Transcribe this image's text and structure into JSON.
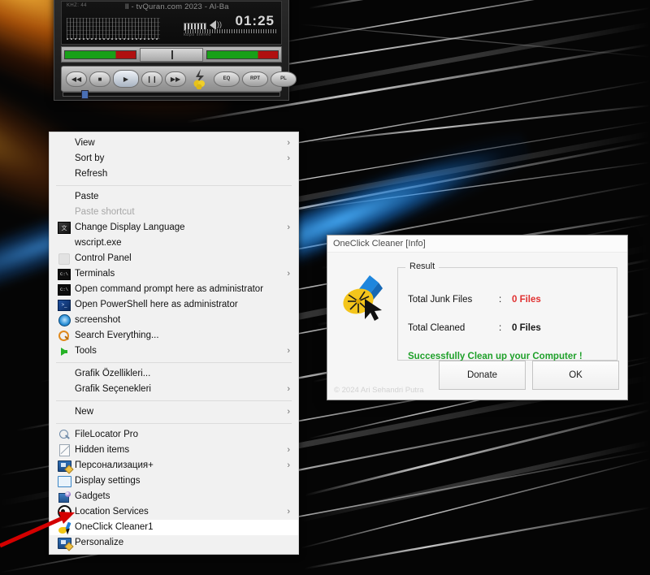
{
  "desktop": {
    "wallpaper_colors": {
      "background": "#050505",
      "orange_streak": "#ff9b1e",
      "blue_streak": "#2f9be0",
      "white_streak": "#cfcfcf"
    },
    "red_arrow_color": "#d40000"
  },
  "player": {
    "title": "ll - tvQuran.com    2023 - Al-Ba",
    "khz": "KHZ:  44",
    "time": "01:25",
    "small_labels": "kbps  stereo",
    "buttons": [
      {
        "name": "previous",
        "glyph": "◀◀"
      },
      {
        "name": "stop",
        "glyph": "■"
      },
      {
        "name": "play",
        "glyph": "▶"
      },
      {
        "name": "pause",
        "glyph": "❙❙"
      },
      {
        "name": "next",
        "glyph": "▶▶"
      }
    ],
    "right_buttons": [
      {
        "name": "equalizer",
        "label": "EQ"
      },
      {
        "name": "repeat",
        "label": "RPT"
      },
      {
        "name": "playlist",
        "label": "PL"
      }
    ]
  },
  "context_menu": {
    "items": [
      {
        "label": "View",
        "icon": "none",
        "arrow": true,
        "disabled": false,
        "selected": false
      },
      {
        "label": "Sort by",
        "icon": "none",
        "arrow": true,
        "disabled": false,
        "selected": false
      },
      {
        "label": "Refresh",
        "icon": "none",
        "arrow": false,
        "disabled": false,
        "selected": false
      },
      {
        "separator": true
      },
      {
        "label": "Paste",
        "icon": "none",
        "arrow": false,
        "disabled": false,
        "selected": false
      },
      {
        "label": "Paste shortcut",
        "icon": "none",
        "arrow": false,
        "disabled": true,
        "selected": false
      },
      {
        "label": "Change Display Language",
        "icon": "lang-icon",
        "arrow": true,
        "disabled": false,
        "selected": false
      },
      {
        "label": "wscript.exe",
        "icon": "none",
        "arrow": false,
        "disabled": false,
        "selected": false
      },
      {
        "label": "Control Panel",
        "icon": "faded-icon",
        "arrow": false,
        "disabled": false,
        "selected": false
      },
      {
        "label": "Terminals",
        "icon": "cmd-icon",
        "arrow": true,
        "disabled": false,
        "selected": false
      },
      {
        "label": "Open command prompt here as administrator",
        "icon": "cmd-icon",
        "arrow": false,
        "disabled": false,
        "selected": false
      },
      {
        "label": "Open PowerShell here as administrator",
        "icon": "powershell-icon",
        "arrow": false,
        "disabled": false,
        "selected": false
      },
      {
        "label": "screenshot",
        "icon": "screenshot-icon",
        "arrow": false,
        "disabled": false,
        "selected": false
      },
      {
        "label": "Search Everything...",
        "icon": "search-icon",
        "arrow": false,
        "disabled": false,
        "selected": false
      },
      {
        "label": "Tools",
        "icon": "green-arrow-icon",
        "arrow": true,
        "disabled": false,
        "selected": false
      },
      {
        "separator": true
      },
      {
        "label": "Grafik Özellikleri...",
        "icon": "none",
        "arrow": false,
        "disabled": false,
        "selected": false
      },
      {
        "label": "Grafik Seçenekleri",
        "icon": "none",
        "arrow": true,
        "disabled": false,
        "selected": false
      },
      {
        "separator": true
      },
      {
        "label": "New",
        "icon": "none",
        "arrow": true,
        "disabled": false,
        "selected": false
      },
      {
        "separator": true
      },
      {
        "label": "FileLocator Pro",
        "icon": "magnifier-icon",
        "arrow": false,
        "disabled": false,
        "selected": false
      },
      {
        "label": "Hidden items",
        "icon": "hidden-items-icon",
        "arrow": true,
        "disabled": false,
        "selected": false
      },
      {
        "label": "Персонализация+",
        "icon": "personalize-icon",
        "arrow": true,
        "disabled": false,
        "selected": false
      },
      {
        "label": "Display settings",
        "icon": "display-icon",
        "arrow": false,
        "disabled": false,
        "selected": false
      },
      {
        "label": "Gadgets",
        "icon": "gadgets-icon",
        "arrow": false,
        "disabled": false,
        "selected": false
      },
      {
        "label": "Location Services",
        "icon": "location-icon",
        "arrow": true,
        "disabled": false,
        "selected": false
      },
      {
        "label": "OneClick Cleaner1",
        "icon": "broom-icon",
        "arrow": false,
        "disabled": false,
        "selected": true
      },
      {
        "label": "Personalize",
        "icon": "personalize-icon",
        "arrow": false,
        "disabled": false,
        "selected": false
      }
    ]
  },
  "dialog": {
    "title": "OneClick Cleaner [Info]",
    "icon_name": "broom-cursor-icon",
    "group_legend": "Result",
    "rows": [
      {
        "key": "Total Junk Files",
        "colon": ":",
        "value": "0 Files",
        "color": "#e03030"
      },
      {
        "key": "Total Cleaned",
        "colon": ":",
        "value": "0 Files",
        "color": "#1a1a1a"
      }
    ],
    "success_message": "Successfully Clean up your Computer !",
    "success_color": "#1fa02a",
    "copyright": "© 2024 Ari Sehandri Putra",
    "buttons": {
      "donate": "Donate",
      "ok": "OK"
    }
  }
}
